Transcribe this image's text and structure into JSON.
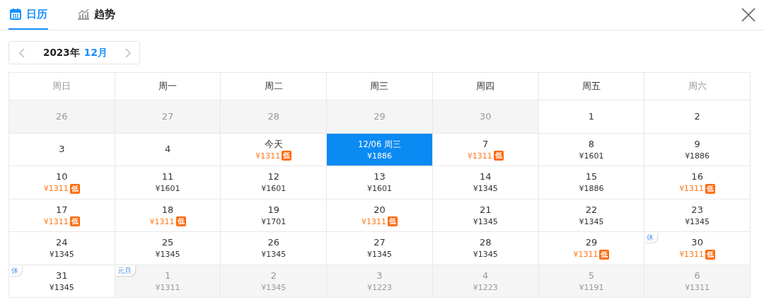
{
  "tabs": [
    {
      "label": "日历",
      "kind": "calendar",
      "selected": true
    },
    {
      "label": "趋势",
      "kind": "trend",
      "selected": false
    }
  ],
  "month_nav": {
    "year": "2023年",
    "month": "12月"
  },
  "weekdays": [
    {
      "label": "周日",
      "weekend": true
    },
    {
      "label": "周一",
      "weekend": false
    },
    {
      "label": "周二",
      "weekend": false
    },
    {
      "label": "周三",
      "weekend": false
    },
    {
      "label": "周四",
      "weekend": false
    },
    {
      "label": "周五",
      "weekend": false
    },
    {
      "label": "周六",
      "weekend": true
    }
  ],
  "days": [
    {
      "label": "26",
      "outside": true,
      "selected": false
    },
    {
      "label": "27",
      "outside": true,
      "selected": false
    },
    {
      "label": "28",
      "outside": true,
      "selected": false
    },
    {
      "label": "29",
      "outside": true,
      "selected": false
    },
    {
      "label": "30",
      "outside": true,
      "selected": false
    },
    {
      "label": "1",
      "outside": false,
      "selected": false
    },
    {
      "label": "2",
      "outside": false,
      "selected": false
    },
    {
      "label": "3",
      "outside": false,
      "selected": false
    },
    {
      "label": "4",
      "outside": false,
      "selected": false
    },
    {
      "label": "今天",
      "price": "¥1311",
      "low": true,
      "badge": "低",
      "outside": false,
      "selected": false
    },
    {
      "label": "12/06 周三",
      "price": "¥1886",
      "low": false,
      "outside": false,
      "selected": true
    },
    {
      "label": "7",
      "price": "¥1311",
      "low": true,
      "badge": "低",
      "outside": false,
      "selected": false
    },
    {
      "label": "8",
      "price": "¥1601",
      "low": false,
      "outside": false,
      "selected": false
    },
    {
      "label": "9",
      "price": "¥1886",
      "low": false,
      "outside": false,
      "selected": false
    },
    {
      "label": "10",
      "price": "¥1311",
      "low": true,
      "badge": "低",
      "outside": false,
      "selected": false
    },
    {
      "label": "11",
      "price": "¥1601",
      "low": false,
      "outside": false,
      "selected": false
    },
    {
      "label": "12",
      "price": "¥1601",
      "low": false,
      "outside": false,
      "selected": false
    },
    {
      "label": "13",
      "price": "¥1601",
      "low": false,
      "outside": false,
      "selected": false
    },
    {
      "label": "14",
      "price": "¥1345",
      "low": false,
      "outside": false,
      "selected": false
    },
    {
      "label": "15",
      "price": "¥1886",
      "low": false,
      "outside": false,
      "selected": false
    },
    {
      "label": "16",
      "price": "¥1311",
      "low": true,
      "badge": "低",
      "outside": false,
      "selected": false
    },
    {
      "label": "17",
      "price": "¥1311",
      "low": true,
      "badge": "低",
      "outside": false,
      "selected": false
    },
    {
      "label": "18",
      "price": "¥1311",
      "low": true,
      "badge": "低",
      "outside": false,
      "selected": false
    },
    {
      "label": "19",
      "price": "¥1701",
      "low": false,
      "outside": false,
      "selected": false
    },
    {
      "label": "20",
      "price": "¥1311",
      "low": true,
      "badge": "低",
      "outside": false,
      "selected": false
    },
    {
      "label": "21",
      "price": "¥1345",
      "low": false,
      "outside": false,
      "selected": false
    },
    {
      "label": "22",
      "price": "¥1345",
      "low": false,
      "outside": false,
      "selected": false
    },
    {
      "label": "23",
      "price": "¥1345",
      "low": false,
      "outside": false,
      "selected": false
    },
    {
      "label": "24",
      "price": "¥1345",
      "low": false,
      "outside": false,
      "selected": false
    },
    {
      "label": "25",
      "price": "¥1345",
      "low": false,
      "outside": false,
      "selected": false
    },
    {
      "label": "26",
      "price": "¥1345",
      "low": false,
      "outside": false,
      "selected": false
    },
    {
      "label": "27",
      "price": "¥1345",
      "low": false,
      "outside": false,
      "selected": false
    },
    {
      "label": "28",
      "price": "¥1345",
      "low": false,
      "outside": false,
      "selected": false
    },
    {
      "label": "29",
      "price": "¥1311",
      "low": true,
      "badge": "低",
      "outside": false,
      "selected": false
    },
    {
      "label": "30",
      "price": "¥1311",
      "low": true,
      "badge": "低",
      "tag": "休",
      "outside": false,
      "selected": false
    },
    {
      "label": "31",
      "price": "¥1345",
      "low": false,
      "tag": "休",
      "outside": false,
      "selected": false
    },
    {
      "label": "1",
      "price": "¥1311",
      "low": false,
      "tag": "元旦",
      "outside": true,
      "selected": false
    },
    {
      "label": "2",
      "price": "¥1345",
      "low": false,
      "outside": true,
      "selected": false
    },
    {
      "label": "3",
      "price": "¥1223",
      "low": false,
      "outside": true,
      "selected": false
    },
    {
      "label": "4",
      "price": "¥1223",
      "low": false,
      "outside": true,
      "selected": false
    },
    {
      "label": "5",
      "price": "¥1191",
      "low": false,
      "outside": true,
      "selected": false
    },
    {
      "label": "6",
      "price": "¥1311",
      "low": false,
      "outside": true,
      "selected": false
    }
  ]
}
